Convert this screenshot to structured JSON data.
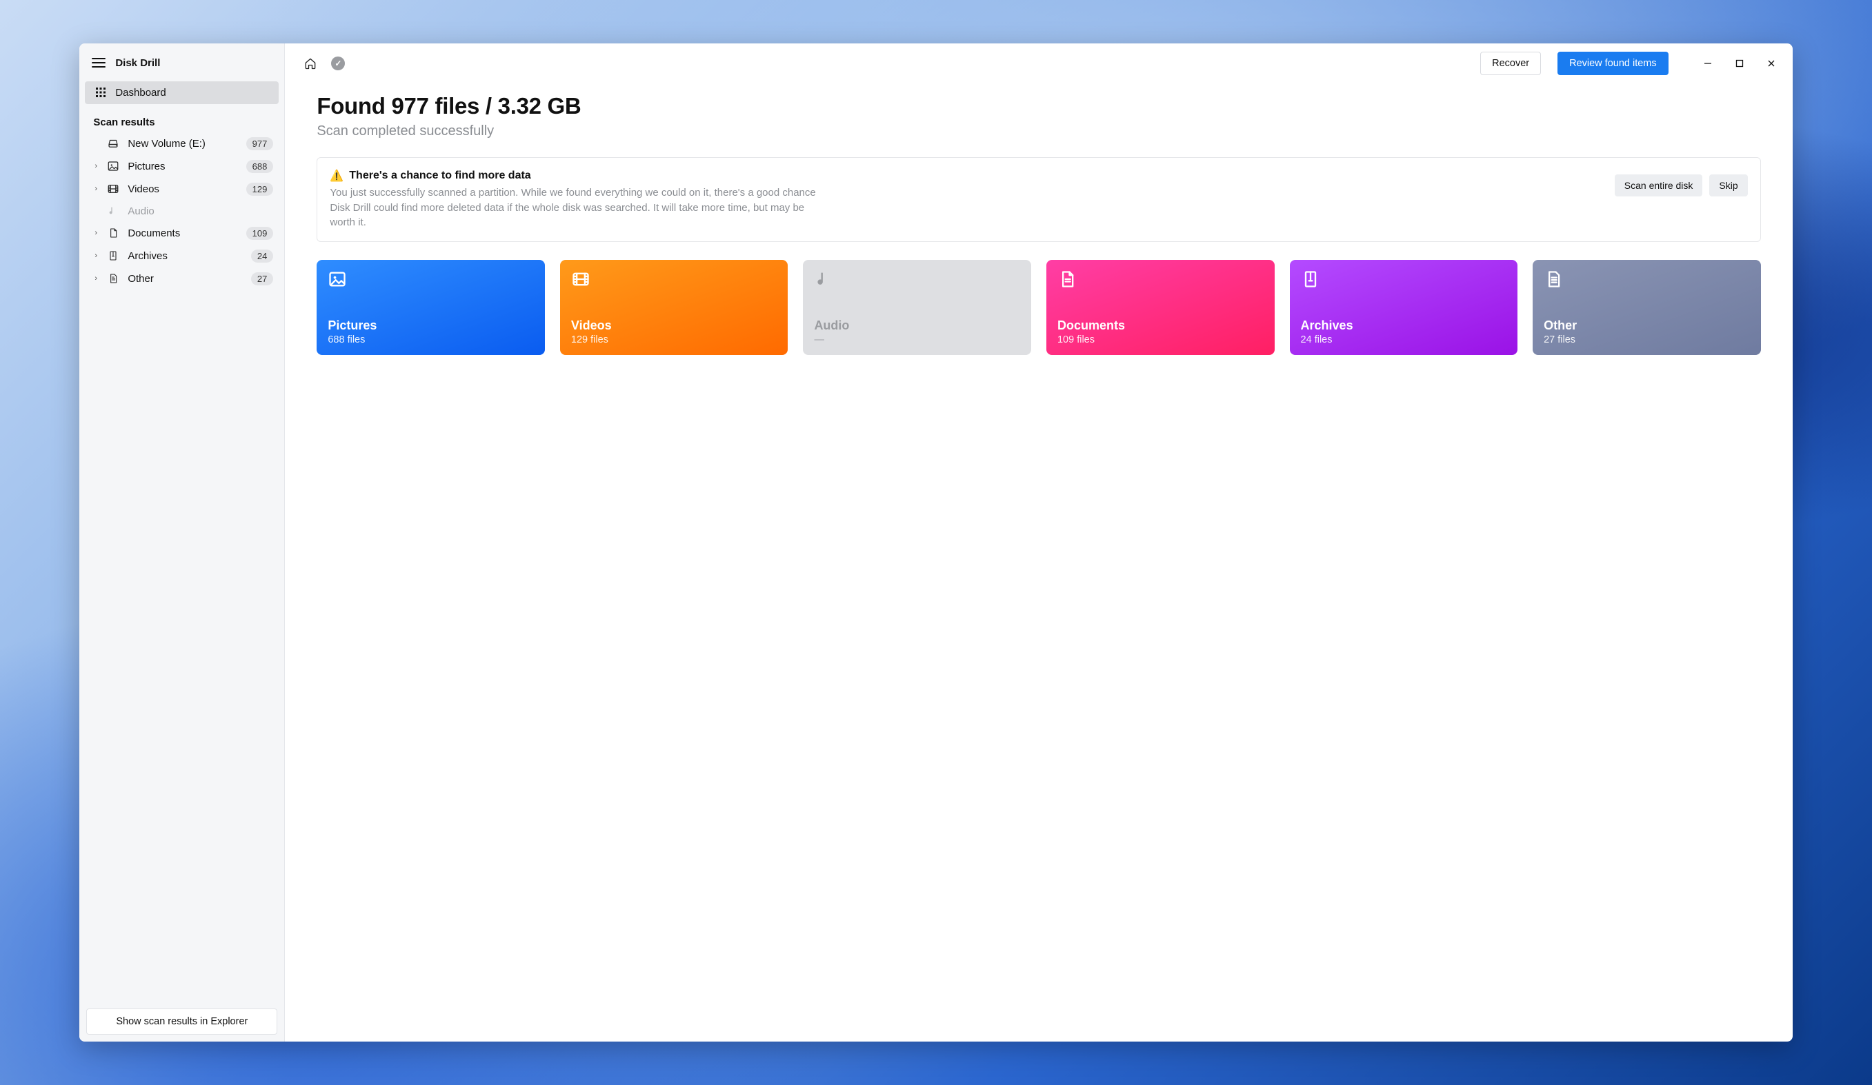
{
  "app": {
    "title": "Disk Drill"
  },
  "sidebar": {
    "dashboard_label": "Dashboard",
    "section_label": "Scan results",
    "volume": {
      "label": "New Volume (E:)",
      "count": "977"
    },
    "items": [
      {
        "label": "Pictures",
        "count": "688"
      },
      {
        "label": "Videos",
        "count": "129"
      },
      {
        "label": "Audio",
        "count": ""
      },
      {
        "label": "Documents",
        "count": "109"
      },
      {
        "label": "Archives",
        "count": "24"
      },
      {
        "label": "Other",
        "count": "27"
      }
    ],
    "explorer_button": "Show scan results in Explorer"
  },
  "toolbar": {
    "recover_label": "Recover",
    "review_label": "Review found items"
  },
  "summary": {
    "headline": "Found 977 files / 3.32 GB",
    "subhead": "Scan completed successfully"
  },
  "notice": {
    "title": "There's a chance to find more data",
    "body": "You just successfully scanned a partition. While we found everything we could on it, there's a good chance Disk Drill could find more deleted data if the whole disk was searched. It will take more time, but may be worth it.",
    "scan_label": "Scan entire disk",
    "skip_label": "Skip"
  },
  "cards": {
    "pictures": {
      "title": "Pictures",
      "sub": "688 files"
    },
    "videos": {
      "title": "Videos",
      "sub": "129 files"
    },
    "audio": {
      "title": "Audio",
      "sub": "—"
    },
    "documents": {
      "title": "Documents",
      "sub": "109 files"
    },
    "archives": {
      "title": "Archives",
      "sub": "24 files"
    },
    "other": {
      "title": "Other",
      "sub": "27 files"
    }
  }
}
